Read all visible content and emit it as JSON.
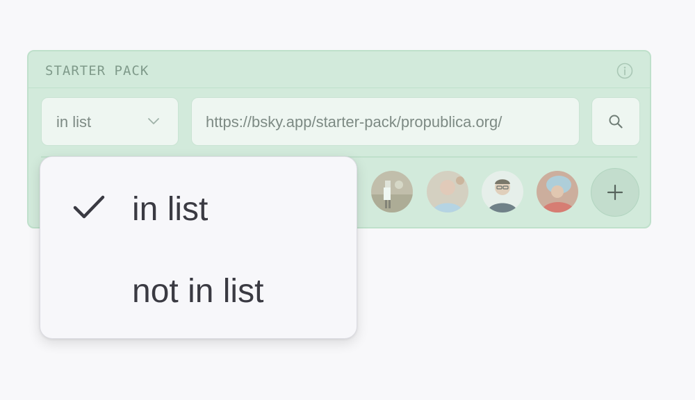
{
  "panel": {
    "title": "STARTER PACK",
    "info_icon": "info-icon"
  },
  "select": {
    "value": "in list",
    "icon": "chevron-down-icon"
  },
  "url_input": {
    "value": "https://bsky.app/starter-pack/propublica.org/"
  },
  "search_button": {
    "icon": "search-icon"
  },
  "avatars": [
    {
      "name": "avatar-1"
    },
    {
      "name": "avatar-2"
    },
    {
      "name": "avatar-3"
    },
    {
      "name": "avatar-4"
    }
  ],
  "add_button": {
    "icon": "plus-icon"
  },
  "dropdown": {
    "options": [
      {
        "label": "in list",
        "selected": true
      },
      {
        "label": "not in list",
        "selected": false
      }
    ]
  },
  "colors": {
    "panel_bg": "#d2eadb",
    "panel_border": "#bfe0cb",
    "menu_text": "#3a3a42"
  }
}
